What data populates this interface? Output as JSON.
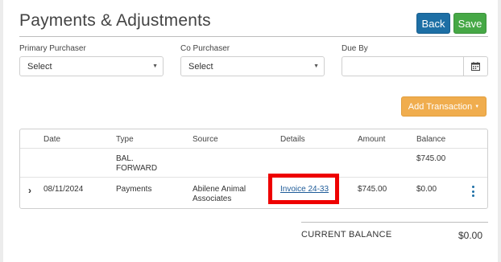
{
  "header": {
    "title": "Payments & Adjustments",
    "back_label": "Back",
    "save_label": "Save"
  },
  "filters": {
    "primary_purchaser": {
      "label": "Primary Purchaser",
      "value": "Select"
    },
    "co_purchaser": {
      "label": "Co Purchaser",
      "value": "Select"
    },
    "due_by": {
      "label": "Due By",
      "value": ""
    }
  },
  "actions": {
    "add_transaction_label": "Add Transaction"
  },
  "table": {
    "columns": [
      "Date",
      "Type",
      "Source",
      "Details",
      "Amount",
      "Balance"
    ],
    "rows": [
      {
        "date": "",
        "type_line1": "BAL.",
        "type_line2": "FORWARD",
        "source_line1": "",
        "source_line2": "",
        "details": "",
        "amount": "",
        "balance": "$745.00"
      },
      {
        "date": "08/11/2024",
        "type_line1": "Payments",
        "type_line2": "",
        "source_line1": "Abilene Animal",
        "source_line2": "Associates",
        "details": "Invoice 24-33",
        "amount": "$745.00",
        "balance": "$0.00"
      }
    ]
  },
  "summary": {
    "current_balance_label": "CURRENT BALANCE",
    "current_balance_value": "$0.00"
  },
  "colors": {
    "back_button": "#1d6fa5",
    "save_button": "#46a846",
    "add_button": "#f0ad4e",
    "highlight": "#ee0000",
    "link": "#1f5c99"
  },
  "icons": [
    "calendar-icon",
    "chevron-right-icon",
    "kebab-menu-icon",
    "caret-down-icon"
  ]
}
